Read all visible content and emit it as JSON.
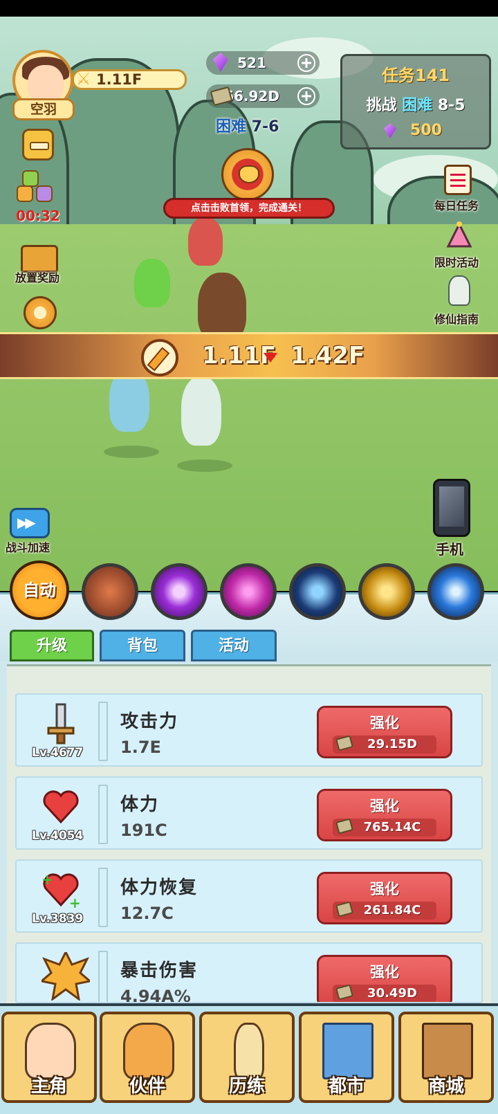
{
  "player": {
    "name": "空羽",
    "power": "1.11F",
    "buff_timer": "00:32"
  },
  "currency": {
    "gems": "521",
    "cash": "66.92D"
  },
  "stage": {
    "difficulty": "困难",
    "level": "7-6"
  },
  "task": {
    "title": "任务141",
    "challenge_prefix": "挑战",
    "challenge_difficulty": "困难",
    "challenge_level": "8-5",
    "reward": "500"
  },
  "boss_hint": "点击击败首领，完成通关！",
  "left_menu": {
    "idle_reward": "放置奖励",
    "speed_up": "战斗加速"
  },
  "right_menu": {
    "daily_task": "每日任务",
    "limited_event": "限时活动",
    "guide": "修仙指南",
    "phone": "手机"
  },
  "power_compare": {
    "mine": "1.11F",
    "enemy": "1.42F"
  },
  "skills": {
    "auto": "自动",
    "icons": [
      "beast-skill-icon",
      "violet-orb-skill-icon",
      "vortex-skill-icon",
      "thunder-talisman-skill-icon",
      "golden-swords-skill-icon",
      "comet-skill-icon"
    ]
  },
  "tabs": [
    "升级",
    "背包",
    "活动"
  ],
  "upgrades": [
    {
      "name": "攻击力",
      "value": "1.7E",
      "level": "Lv.4677",
      "btn": "强化",
      "cost": "29.15D"
    },
    {
      "name": "体力",
      "value": "191C",
      "level": "Lv.4054",
      "btn": "强化",
      "cost": "765.14C"
    },
    {
      "name": "体力恢复",
      "value": "12.7C",
      "level": "Lv.3839",
      "btn": "强化",
      "cost": "261.84C"
    },
    {
      "name": "暴击伤害",
      "value": "4.94A%",
      "level": "",
      "btn": "强化",
      "cost": "30.49D"
    }
  ],
  "nav": [
    "主角",
    "伙伴",
    "历练",
    "都市",
    "商城"
  ],
  "colors": {
    "accent_red": "#d94545",
    "tab_green": "#6fd04a",
    "tab_blue": "#4fb1e6",
    "gold": "#f8d27a"
  }
}
